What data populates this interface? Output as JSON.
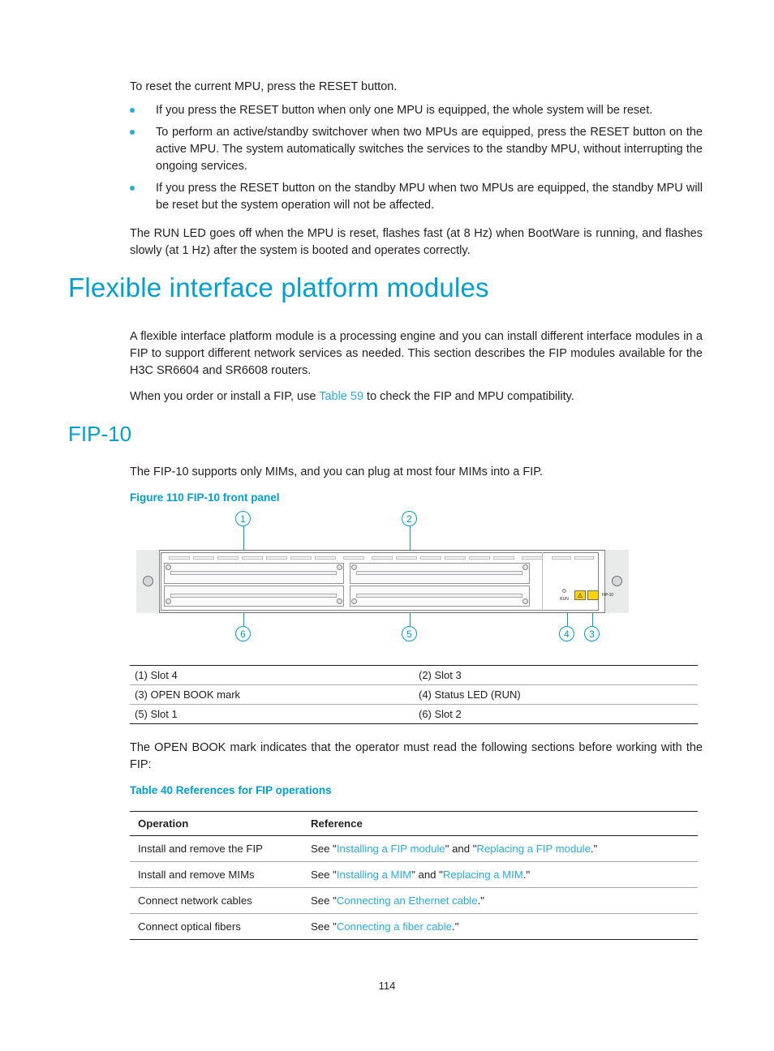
{
  "intro": {
    "line": "To reset the current MPU, press the RESET button.",
    "bullets": [
      "If you press the RESET button when only one MPU is equipped, the whole system will be reset.",
      "To perform an active/standby switchover when two MPUs are equipped, press the RESET button on the active MPU. The system automatically switches the services to the standby MPU, without interrupting the ongoing services.",
      "If you press the RESET button on the standby MPU when two MPUs are equipped, the standby MPU will be reset but the system operation will not be affected."
    ],
    "run_led_para": "The RUN LED goes off when the MPU is reset, flashes fast (at 8 Hz) when BootWare is running, and flashes slowly (at 1 Hz) after the system is booted and operates correctly."
  },
  "chapter": {
    "title": "Flexible interface platform modules",
    "para1": "A flexible interface platform module is a processing engine and you can install different interface modules in a FIP to support different network services as needed. This section describes the FIP modules available for the H3C SR6604 and SR6608 routers.",
    "para2_before": "When you order or install a FIP, use ",
    "para2_link": "Table 59",
    "para2_after": " to check the FIP and MPU compatibility."
  },
  "section": {
    "title": "FIP-10",
    "para": "The FIP-10 supports only MIMs, and you can plug at most four MIMs into a FIP."
  },
  "figure": {
    "caption": "Figure 110 FIP-10 front panel",
    "callouts": [
      "1",
      "2",
      "6",
      "5",
      "4",
      "3"
    ],
    "device_label": "FIP-10",
    "warn_glyph": "⚠",
    "run_label": "RUN",
    "legend": [
      [
        "(1) Slot 4",
        "(2) Slot 3"
      ],
      [
        "(3) OPEN BOOK mark",
        "(4) Status LED (RUN)"
      ],
      [
        "(5) Slot 1",
        "(6) Slot 2"
      ]
    ]
  },
  "openbook_para": "The OPEN BOOK mark indicates that the operator must read the following sections before working with the FIP:",
  "table": {
    "caption": "Table 40 References for FIP operations",
    "headers": [
      "Operation",
      "Reference"
    ],
    "rows": [
      {
        "operation": "Install and remove the FIP",
        "ref_parts": [
          {
            "text": "See \"",
            "link": false
          },
          {
            "text": "Installing a FIP module",
            "link": true
          },
          {
            "text": "\" and \"",
            "link": false
          },
          {
            "text": "Replacing a FIP module",
            "link": true
          },
          {
            "text": ".\"",
            "link": false
          }
        ]
      },
      {
        "operation": "Install and remove MIMs",
        "ref_parts": [
          {
            "text": "See \"",
            "link": false
          },
          {
            "text": "Installing a MIM",
            "link": true
          },
          {
            "text": "\" and \"",
            "link": false
          },
          {
            "text": "Replacing a MIM",
            "link": true
          },
          {
            "text": ".\"",
            "link": false
          }
        ]
      },
      {
        "operation": "Connect network cables",
        "ref_parts": [
          {
            "text": "See \"",
            "link": false
          },
          {
            "text": "Connecting an Ethernet cable",
            "link": true
          },
          {
            "text": ".\"",
            "link": false
          }
        ]
      },
      {
        "operation": "Connect optical fibers",
        "ref_parts": [
          {
            "text": "See \"",
            "link": false
          },
          {
            "text": "Connecting a fiber cable",
            "link": true
          },
          {
            "text": ".\"",
            "link": false
          }
        ]
      }
    ]
  },
  "page_number": "114",
  "colors": {
    "accent": "#00a0d2",
    "link": "#29abe2",
    "text": "#231f20"
  }
}
